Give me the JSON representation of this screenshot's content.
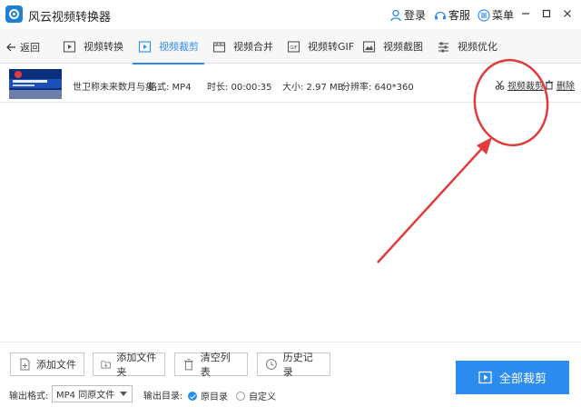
{
  "app": {
    "title": "风云视频转换器",
    "login": "登录",
    "service": "客服",
    "menu": "菜单"
  },
  "nav": {
    "back": "返回",
    "tabs": [
      {
        "label": "视频转换",
        "icon": "video-convert-icon"
      },
      {
        "label": "视频裁剪",
        "icon": "video-crop-icon",
        "active": true
      },
      {
        "label": "视频合并",
        "icon": "video-merge-icon"
      },
      {
        "label": "视频转GIF",
        "icon": "gif-icon"
      },
      {
        "label": "视频截图",
        "icon": "screenshot-icon"
      },
      {
        "label": "视频优化",
        "icon": "optimize-icon"
      }
    ]
  },
  "file": {
    "name": "世卫称未来数月与疫...",
    "format": "格式: MP4",
    "duration": "时长: 00:00:35",
    "size": "大小: 2.97 MB",
    "resolution": "分辨率: 640*360",
    "cut_label": "视频裁剪",
    "delete_label": "删除"
  },
  "bottom": {
    "add_file": "添加文件",
    "add_folder": "添加文件夹",
    "clear_list": "清空列表",
    "history": "历史记录",
    "output_format_label": "输出格式:",
    "output_format_value": "MP4 同原文件",
    "output_dir_label": "输出目录:",
    "option_original": "原目录",
    "option_custom": "自定义",
    "selected_option": "原目录",
    "primary": "全部裁剪"
  },
  "colors": {
    "accent": "#2d8cf0",
    "annotation": "#e03c3c"
  }
}
